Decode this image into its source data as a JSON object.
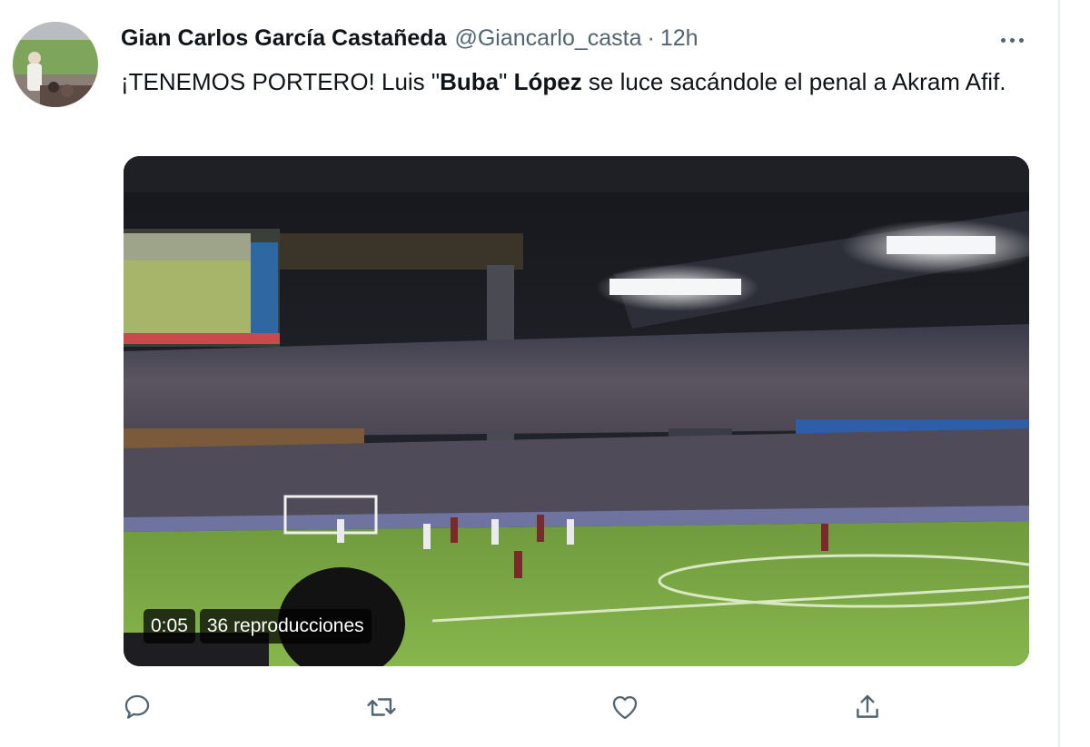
{
  "tweet": {
    "author": {
      "display_name": "Gian Carlos García Castañeda",
      "handle": "@Giancarlo_casta",
      "separator": "·",
      "time": "12h"
    },
    "text_parts": {
      "p1": "¡TENEMOS PORTERO! Luis \"",
      "p2": "Buba",
      "p3": "\" ",
      "p4": "López",
      "p5": " se luce sacándole el penal a Akram Afif."
    },
    "video": {
      "duration": "0:05",
      "views": "36 reproducciones"
    },
    "actions": {
      "reply_icon": "reply-icon",
      "retweet_icon": "retweet-icon",
      "like_icon": "like-icon",
      "share_icon": "share-icon"
    },
    "colors": {
      "text": "#0f1419",
      "secondary": "#536471",
      "divider": "#e6ecf0"
    }
  }
}
